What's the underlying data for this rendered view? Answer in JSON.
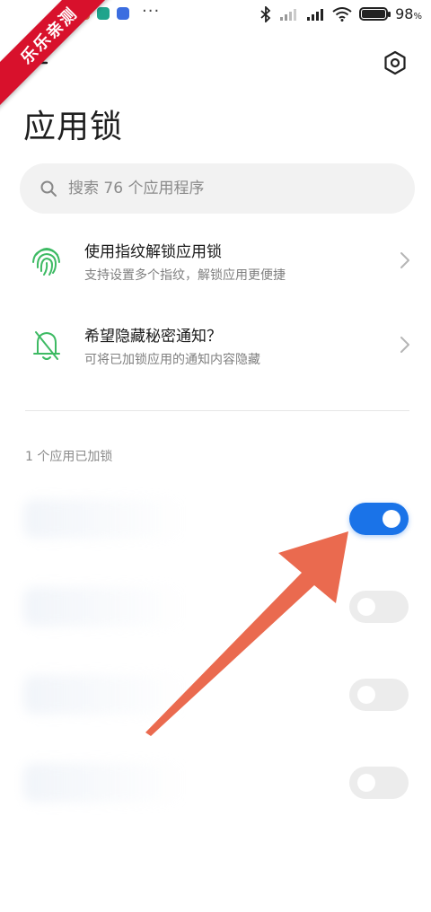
{
  "status_bar": {
    "more": "···",
    "battery_pct": "98",
    "battery_unit": "%",
    "app_icon_colors": [
      "#f47b54",
      "#1fa48c",
      "#3b6de0"
    ]
  },
  "watermark": {
    "text": "乐乐亲测"
  },
  "header": {
    "back_icon": "back-arrow-icon",
    "settings_icon": "settings-hexagon-icon",
    "title": "应用锁"
  },
  "search": {
    "placeholder": "搜索 76 个应用程序"
  },
  "features": [
    {
      "title": "使用指纹解锁应用锁",
      "subtitle": "支持设置多个指纹，解锁应用更便捷",
      "icon": "fingerprint-icon"
    },
    {
      "title": "希望隐藏秘密通知？",
      "subtitle": "可将已加锁应用的通知内容隐藏",
      "icon": "bell-off-icon"
    }
  ],
  "section": {
    "label": "1 个应用已加锁"
  },
  "apps": [
    {
      "toggle_on": true
    },
    {
      "toggle_on": false
    },
    {
      "toggle_on": false
    },
    {
      "toggle_on": false
    }
  ],
  "colors": {
    "accent": "#1a73e8",
    "icon_green": "#3dba63",
    "annotation_arrow": "#ea6a4f",
    "watermark_red": "#d8112c"
  }
}
